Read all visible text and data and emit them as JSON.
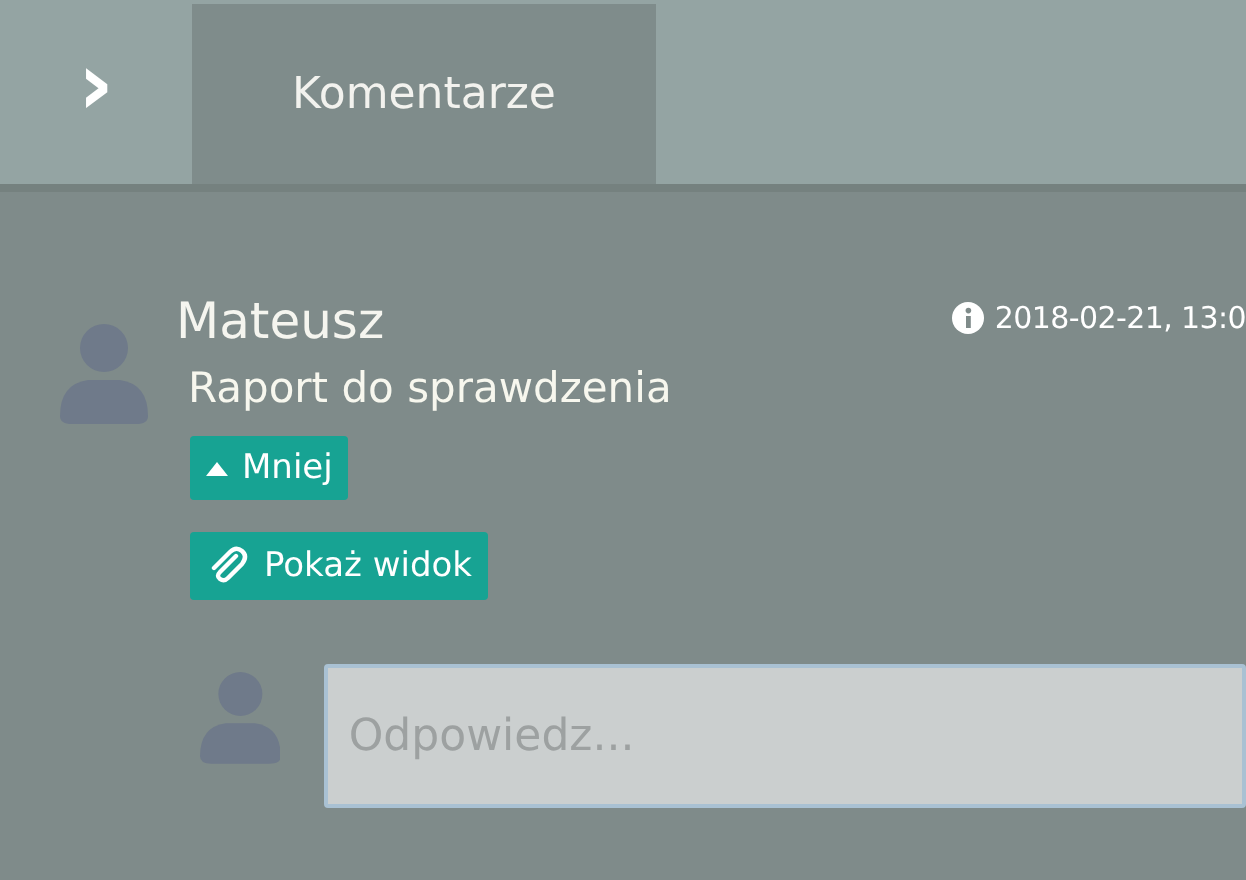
{
  "toggle": {
    "glyph": "›"
  },
  "tabs": [
    {
      "label": "Komentarze",
      "selected": true
    }
  ],
  "comment": {
    "author": "Mateusz",
    "date": "2018-02-21, 13:0",
    "text": "Raport do sprawdzenia",
    "actions": [
      {
        "kind": "collapse",
        "label": "Mniej"
      },
      {
        "kind": "attachment",
        "label": "Pokaż widok"
      }
    ]
  },
  "reply": {
    "placeholder": "Odpowiedz..."
  }
}
